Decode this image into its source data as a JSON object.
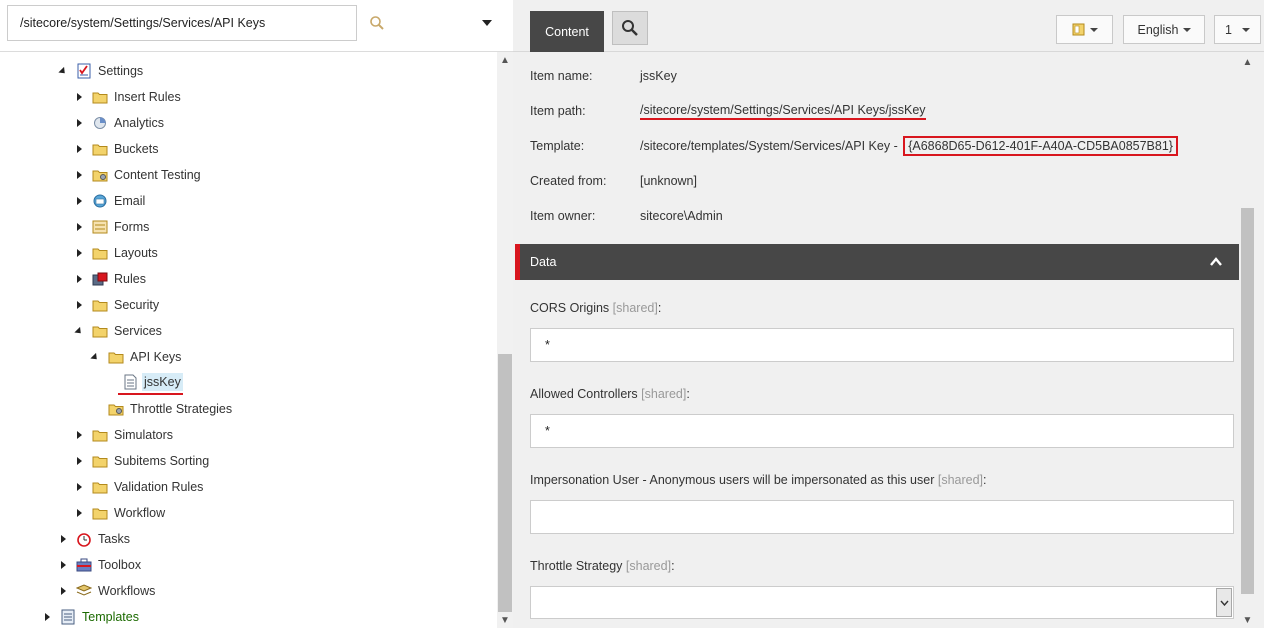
{
  "search": {
    "path_value": "/sitecore/system/Settings/Services/API Keys"
  },
  "tree": {
    "items": [
      {
        "label": "Settings",
        "icon": "settings-checklist-icon",
        "expanded": true
      },
      {
        "label": "Insert Rules",
        "icon": "folder-icon"
      },
      {
        "label": "Analytics",
        "icon": "analytics-icon"
      },
      {
        "label": "Buckets",
        "icon": "folder-icon"
      },
      {
        "label": "Content Testing",
        "icon": "folder-gear-icon"
      },
      {
        "label": "Email",
        "icon": "email-icon"
      },
      {
        "label": "Forms",
        "icon": "forms-icon"
      },
      {
        "label": "Layouts",
        "icon": "folder-icon"
      },
      {
        "label": "Rules",
        "icon": "rules-icon"
      },
      {
        "label": "Security",
        "icon": "folder-icon"
      },
      {
        "label": "Services",
        "icon": "folder-icon",
        "expanded": true
      },
      {
        "label": "API Keys",
        "icon": "folder-icon",
        "expanded": true
      },
      {
        "label": "jssKey",
        "icon": "document-icon",
        "selected": true
      },
      {
        "label": "Throttle Strategies",
        "icon": "folder-gear-icon"
      },
      {
        "label": "Simulators",
        "icon": "folder-icon"
      },
      {
        "label": "Subitems Sorting",
        "icon": "folder-icon"
      },
      {
        "label": "Validation Rules",
        "icon": "folder-icon"
      },
      {
        "label": "Workflow",
        "icon": "folder-icon"
      },
      {
        "label": "Tasks",
        "icon": "alarm-clock-icon"
      },
      {
        "label": "Toolbox",
        "icon": "toolbox-icon"
      },
      {
        "label": "Workflows",
        "icon": "workflows-icon"
      },
      {
        "label": "Templates",
        "icon": "templates-icon"
      }
    ]
  },
  "toolbar": {
    "content_tab": "Content",
    "language": "English",
    "version": "1"
  },
  "item_info": {
    "item_name_label": "Item name:",
    "item_name": "jssKey",
    "item_path_label": "Item path:",
    "item_path": "/sitecore/system/Settings/Services/API Keys/jssKey",
    "template_label": "Template:",
    "template_path": "/sitecore/templates/System/Services/API Key - ",
    "template_id": "{A6868D65-D612-401F-A40A-CD5BA0857B81}",
    "created_from_label": "Created from:",
    "created_from": "[unknown]",
    "owner_label": "Item owner:",
    "owner": "sitecore\\Admin"
  },
  "data_section": {
    "title": "Data",
    "fields": [
      {
        "label": "CORS Origins",
        "shared": "[shared]",
        "colon": ":",
        "value": "*"
      },
      {
        "label": "Allowed Controllers",
        "shared": "[shared]",
        "colon": ":",
        "value": "*"
      },
      {
        "label": "Impersonation User - Anonymous users will be impersonated as this user",
        "shared": "[shared]",
        "colon": ":",
        "value": ""
      },
      {
        "label": "Throttle Strategy",
        "shared": "[shared]",
        "colon": ":",
        "value": ""
      }
    ]
  },
  "colors": {
    "highlight_red": "#d8161e",
    "section_bar": "#474747",
    "selected_bg": "#d7ecf7",
    "templates_green": "#1b6a00"
  }
}
